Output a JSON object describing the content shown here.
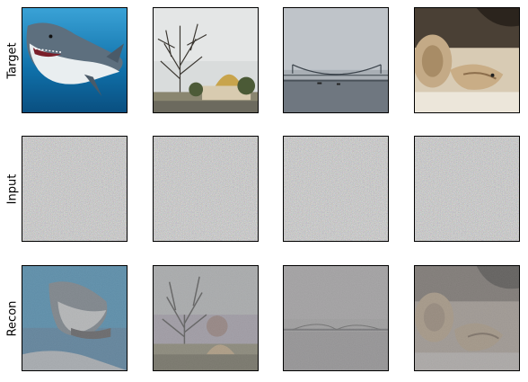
{
  "rows": [
    {
      "label": "Target",
      "images": [
        "shark",
        "tree-with-dome-building",
        "bridge-over-water",
        "coiled-snake-on-sand"
      ]
    },
    {
      "label": "Input",
      "images": [
        "gray-noise",
        "gray-noise",
        "gray-noise",
        "gray-noise"
      ]
    },
    {
      "label": "Recon",
      "images": [
        "shark-reconstruction",
        "tree-with-dome-reconstruction",
        "bridge-water-reconstruction",
        "snake-reconstruction"
      ]
    }
  ]
}
